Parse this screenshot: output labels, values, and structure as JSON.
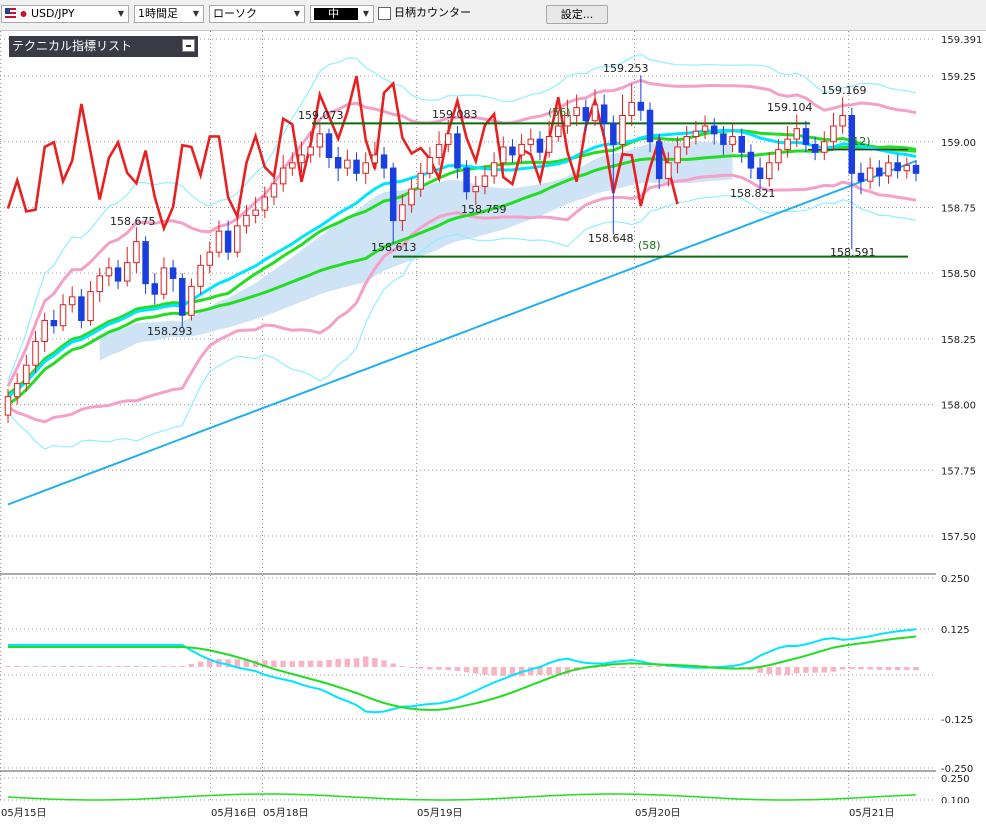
{
  "toolbar": {
    "symbol": "USD/JPY",
    "timeframe": "1時間足",
    "chart_type": "ローソク",
    "line_weight": "中",
    "counter": "日柄カウンター",
    "settings": "設定..."
  },
  "indicator_panel": {
    "title": "テクニカル指標リスト"
  },
  "colors": {
    "bull_body": "#ffffff",
    "bull_border": "#e02020",
    "bear_body": "#1a3fe0",
    "cloud": "#cfe3f7",
    "lagging": "#e82020",
    "bollinger_mid": "#00e5ff",
    "bollinger_outer": "#8ff0ff",
    "band_pink": "#f4a0c8",
    "ma_green": "#22dd22",
    "long_ma": "#20b0f0",
    "macd": "#00e5ff",
    "signal": "#22dd22",
    "hist": "#f8b4c4",
    "support": "#0a6e0a"
  },
  "chart_data": {
    "type": "candlestick",
    "price_axis": {
      "ticks": [
        "159.391",
        "159.25",
        "159.00",
        "158.75",
        "158.50",
        "158.25",
        "158.00",
        "157.75",
        "157.50"
      ],
      "range": [
        157.428,
        159.391
      ]
    },
    "date_labels": [
      "05月15日",
      "05月16日",
      "05月18日",
      "05月19日",
      "05月20日",
      "05月21日"
    ],
    "annotations": {
      "highs": [
        "159.253",
        "159.073",
        "159.083",
        "159.104",
        "159.169",
        "158.675"
      ],
      "lows": [
        "158.293",
        "158.613",
        "158.759",
        "158.648",
        "158.821",
        "158.591"
      ],
      "counts": [
        "(56)",
        "(58)",
        "(12)"
      ]
    },
    "macd_axis": {
      "ticks": [
        "0.250",
        "0.125",
        "-0.125",
        "-0.250"
      ]
    },
    "rsi_axis": {
      "ticks": [
        "0.250",
        "0.100"
      ]
    },
    "candles": [
      {
        "o": 157.96,
        "c": 158.03,
        "h": 158.06,
        "l": 157.93
      },
      {
        "o": 158.03,
        "c": 158.08,
        "h": 158.12,
        "l": 158.0
      },
      {
        "o": 158.08,
        "c": 158.15,
        "h": 158.19,
        "l": 158.05
      },
      {
        "o": 158.15,
        "c": 158.24,
        "h": 158.28,
        "l": 158.12
      },
      {
        "o": 158.24,
        "c": 158.32,
        "h": 158.35,
        "l": 158.2
      },
      {
        "o": 158.32,
        "c": 158.3,
        "h": 158.36,
        "l": 158.27
      },
      {
        "o": 158.3,
        "c": 158.38,
        "h": 158.42,
        "l": 158.28
      },
      {
        "o": 158.38,
        "c": 158.41,
        "h": 158.45,
        "l": 158.35
      },
      {
        "o": 158.41,
        "c": 158.32,
        "h": 158.44,
        "l": 158.29
      },
      {
        "o": 158.32,
        "c": 158.43,
        "h": 158.47,
        "l": 158.3
      },
      {
        "o": 158.43,
        "c": 158.49,
        "h": 158.52,
        "l": 158.39
      },
      {
        "o": 158.49,
        "c": 158.52,
        "h": 158.56,
        "l": 158.45
      },
      {
        "o": 158.52,
        "c": 158.47,
        "h": 158.55,
        "l": 158.44
      },
      {
        "o": 158.47,
        "c": 158.54,
        "h": 158.6,
        "l": 158.45
      },
      {
        "o": 158.54,
        "c": 158.62,
        "h": 158.675,
        "l": 158.5
      },
      {
        "o": 158.62,
        "c": 158.46,
        "h": 158.64,
        "l": 158.42
      },
      {
        "o": 158.46,
        "c": 158.42,
        "h": 158.5,
        "l": 158.38
      },
      {
        "o": 158.42,
        "c": 158.52,
        "h": 158.56,
        "l": 158.4
      },
      {
        "o": 158.52,
        "c": 158.48,
        "h": 158.55,
        "l": 158.43
      },
      {
        "o": 158.48,
        "c": 158.34,
        "h": 158.5,
        "l": 158.293
      },
      {
        "o": 158.34,
        "c": 158.45,
        "h": 158.48,
        "l": 158.32
      },
      {
        "o": 158.45,
        "c": 158.53,
        "h": 158.57,
        "l": 158.42
      },
      {
        "o": 158.53,
        "c": 158.58,
        "h": 158.62,
        "l": 158.5
      },
      {
        "o": 158.58,
        "c": 158.66,
        "h": 158.7,
        "l": 158.56
      },
      {
        "o": 158.66,
        "c": 158.58,
        "h": 158.7,
        "l": 158.55
      },
      {
        "o": 158.58,
        "c": 158.68,
        "h": 158.72,
        "l": 158.56
      },
      {
        "o": 158.68,
        "c": 158.72,
        "h": 158.76,
        "l": 158.65
      },
      {
        "o": 158.72,
        "c": 158.74,
        "h": 158.79,
        "l": 158.69
      },
      {
        "o": 158.74,
        "c": 158.79,
        "h": 158.83,
        "l": 158.71
      },
      {
        "o": 158.79,
        "c": 158.84,
        "h": 158.87,
        "l": 158.76
      },
      {
        "o": 158.84,
        "c": 158.9,
        "h": 158.95,
        "l": 158.81
      },
      {
        "o": 158.9,
        "c": 158.92,
        "h": 158.96,
        "l": 158.87
      },
      {
        "o": 158.92,
        "c": 158.95,
        "h": 159.0,
        "l": 158.88
      },
      {
        "o": 158.95,
        "c": 158.98,
        "h": 159.04,
        "l": 158.92
      },
      {
        "o": 158.98,
        "c": 159.03,
        "h": 159.073,
        "l": 158.94
      },
      {
        "o": 159.03,
        "c": 158.94,
        "h": 159.05,
        "l": 158.9
      },
      {
        "o": 158.94,
        "c": 158.9,
        "h": 158.98,
        "l": 158.85
      },
      {
        "o": 158.9,
        "c": 158.93,
        "h": 158.97,
        "l": 158.87
      },
      {
        "o": 158.93,
        "c": 158.88,
        "h": 158.96,
        "l": 158.85
      },
      {
        "o": 158.88,
        "c": 158.92,
        "h": 158.96,
        "l": 158.84
      },
      {
        "o": 158.92,
        "c": 158.95,
        "h": 159.0,
        "l": 158.89
      },
      {
        "o": 158.95,
        "c": 158.9,
        "h": 158.98,
        "l": 158.86
      },
      {
        "o": 158.9,
        "c": 158.7,
        "h": 158.92,
        "l": 158.613
      },
      {
        "o": 158.7,
        "c": 158.76,
        "h": 158.8,
        "l": 158.66
      },
      {
        "o": 158.76,
        "c": 158.82,
        "h": 158.86,
        "l": 158.73
      },
      {
        "o": 158.82,
        "c": 158.88,
        "h": 158.92,
        "l": 158.79
      },
      {
        "o": 158.88,
        "c": 158.94,
        "h": 158.98,
        "l": 158.86
      },
      {
        "o": 158.94,
        "c": 158.99,
        "h": 159.04,
        "l": 158.91
      },
      {
        "o": 158.99,
        "c": 159.03,
        "h": 159.083,
        "l": 158.96
      },
      {
        "o": 159.03,
        "c": 158.9,
        "h": 159.06,
        "l": 158.86
      },
      {
        "o": 158.9,
        "c": 158.81,
        "h": 158.93,
        "l": 158.78
      },
      {
        "o": 158.81,
        "c": 158.83,
        "h": 158.87,
        "l": 158.759
      },
      {
        "o": 158.83,
        "c": 158.87,
        "h": 158.91,
        "l": 158.8
      },
      {
        "o": 158.87,
        "c": 158.92,
        "h": 158.96,
        "l": 158.84
      },
      {
        "o": 158.92,
        "c": 158.98,
        "h": 159.02,
        "l": 158.89
      },
      {
        "o": 158.98,
        "c": 158.95,
        "h": 159.01,
        "l": 158.92
      },
      {
        "o": 158.95,
        "c": 158.99,
        "h": 159.03,
        "l": 158.92
      },
      {
        "o": 158.99,
        "c": 159.01,
        "h": 159.05,
        "l": 158.96
      },
      {
        "o": 159.01,
        "c": 158.96,
        "h": 159.04,
        "l": 158.93
      },
      {
        "o": 158.96,
        "c": 159.02,
        "h": 159.08,
        "l": 158.94
      },
      {
        "o": 159.02,
        "c": 159.06,
        "h": 159.12,
        "l": 159.0
      },
      {
        "o": 159.06,
        "c": 159.1,
        "h": 159.16,
        "l": 159.03
      },
      {
        "o": 159.1,
        "c": 159.13,
        "h": 159.18,
        "l": 159.06
      },
      {
        "o": 159.13,
        "c": 159.08,
        "h": 159.16,
        "l": 159.04
      },
      {
        "o": 159.08,
        "c": 159.14,
        "h": 159.2,
        "l": 159.06
      },
      {
        "o": 159.14,
        "c": 159.07,
        "h": 159.18,
        "l": 159.02
      },
      {
        "o": 159.07,
        "c": 158.99,
        "h": 159.1,
        "l": 158.648
      },
      {
        "o": 158.99,
        "c": 159.1,
        "h": 159.18,
        "l": 158.95
      },
      {
        "o": 159.1,
        "c": 159.15,
        "h": 159.22,
        "l": 159.06
      },
      {
        "o": 159.15,
        "c": 159.12,
        "h": 159.253,
        "l": 159.08
      },
      {
        "o": 159.12,
        "c": 159.0,
        "h": 159.15,
        "l": 158.96
      },
      {
        "o": 159.0,
        "c": 158.86,
        "h": 159.03,
        "l": 158.82
      },
      {
        "o": 158.86,
        "c": 158.92,
        "h": 158.96,
        "l": 158.83
      },
      {
        "o": 158.92,
        "c": 158.98,
        "h": 159.02,
        "l": 158.88
      },
      {
        "o": 158.98,
        "c": 159.02,
        "h": 159.06,
        "l": 158.95
      },
      {
        "o": 159.02,
        "c": 159.04,
        "h": 159.08,
        "l": 158.99
      },
      {
        "o": 159.04,
        "c": 159.06,
        "h": 159.1,
        "l": 159.01
      },
      {
        "o": 159.06,
        "c": 159.03,
        "h": 159.09,
        "l": 158.99
      },
      {
        "o": 159.03,
        "c": 158.99,
        "h": 159.06,
        "l": 158.95
      },
      {
        "o": 158.99,
        "c": 159.02,
        "h": 159.07,
        "l": 158.96
      },
      {
        "o": 159.02,
        "c": 158.96,
        "h": 159.05,
        "l": 158.92
      },
      {
        "o": 158.96,
        "c": 158.9,
        "h": 158.99,
        "l": 158.86
      },
      {
        "o": 158.9,
        "c": 158.86,
        "h": 158.94,
        "l": 158.821
      },
      {
        "o": 158.86,
        "c": 158.92,
        "h": 158.96,
        "l": 158.83
      },
      {
        "o": 158.92,
        "c": 158.97,
        "h": 159.01,
        "l": 158.89
      },
      {
        "o": 158.97,
        "c": 159.01,
        "h": 159.06,
        "l": 158.94
      },
      {
        "o": 159.01,
        "c": 159.05,
        "h": 159.104,
        "l": 158.98
      },
      {
        "o": 159.05,
        "c": 158.99,
        "h": 159.08,
        "l": 158.96
      },
      {
        "o": 158.99,
        "c": 158.96,
        "h": 159.02,
        "l": 158.93
      },
      {
        "o": 158.96,
        "c": 159.0,
        "h": 159.04,
        "l": 158.93
      },
      {
        "o": 159.0,
        "c": 159.06,
        "h": 159.11,
        "l": 158.97
      },
      {
        "o": 159.06,
        "c": 159.1,
        "h": 159.169,
        "l": 159.03
      },
      {
        "o": 159.1,
        "c": 158.88,
        "h": 159.13,
        "l": 158.591
      },
      {
        "o": 158.88,
        "c": 158.85,
        "h": 158.92,
        "l": 158.8
      },
      {
        "o": 158.85,
        "c": 158.9,
        "h": 158.94,
        "l": 158.82
      },
      {
        "o": 158.9,
        "c": 158.87,
        "h": 158.93,
        "l": 158.83
      },
      {
        "o": 158.87,
        "c": 158.92,
        "h": 158.95,
        "l": 158.84
      },
      {
        "o": 158.92,
        "c": 158.89,
        "h": 158.95,
        "l": 158.86
      },
      {
        "o": 158.89,
        "c": 158.91,
        "h": 158.94,
        "l": 158.86
      },
      {
        "o": 158.91,
        "c": 158.88,
        "h": 158.93,
        "l": 158.85
      }
    ]
  }
}
